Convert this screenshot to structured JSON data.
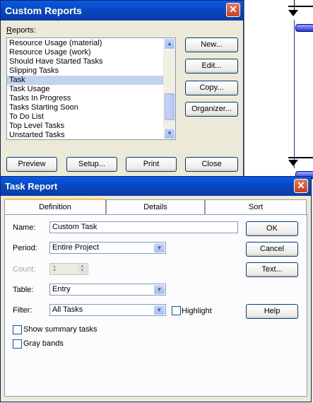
{
  "custom_reports": {
    "title": "Custom Reports",
    "reports_label": "Reports:",
    "items": [
      "Resource Usage (material)",
      "Resource Usage (work)",
      "Should Have Started Tasks",
      "Slipping Tasks",
      "Task",
      "Task Usage",
      "Tasks In Progress",
      "Tasks Starting Soon",
      "To Do List",
      "Top Level Tasks",
      "Unstarted Tasks"
    ],
    "selected_index": 4,
    "buttons": {
      "new": "New...",
      "edit": "Edit...",
      "copy": "Copy...",
      "organizer": "Organizer..."
    },
    "bottom_buttons": {
      "preview": "Preview",
      "setup": "Setup...",
      "print": "Print",
      "close": "Close"
    },
    "close_glyph": "✕"
  },
  "task_report": {
    "title": "Task Report",
    "close_glyph": "✕",
    "tabs": [
      "Definition",
      "Details",
      "Sort"
    ],
    "active_tab": "Definition",
    "name": {
      "label": "Name:",
      "value": "Custom Task"
    },
    "period": {
      "label": "Period:",
      "value": "Entire Project"
    },
    "count": {
      "label": "Count:",
      "value": "1"
    },
    "table": {
      "label": "Table:",
      "value": "Entry"
    },
    "filter": {
      "label": "Filter:",
      "value": "All Tasks"
    },
    "highlight_label": "Highlight",
    "show_summary_label": "Show summary tasks",
    "gray_bands_label": "Gray bands",
    "buttons": {
      "ok": "OK",
      "cancel": "Cancel",
      "text": "Text...",
      "help": "Help"
    }
  },
  "icons": {
    "dropdown": "chevron-down-icon",
    "scroll_up": "scroll-up-icon",
    "scroll_down": "scroll-down-icon",
    "close": "close-icon"
  },
  "colors": {
    "titlebar": "#0a4fd0",
    "selection": "#c1d2ee",
    "tab_highlight": "#ffc83c",
    "close_button": "#d2502a"
  }
}
